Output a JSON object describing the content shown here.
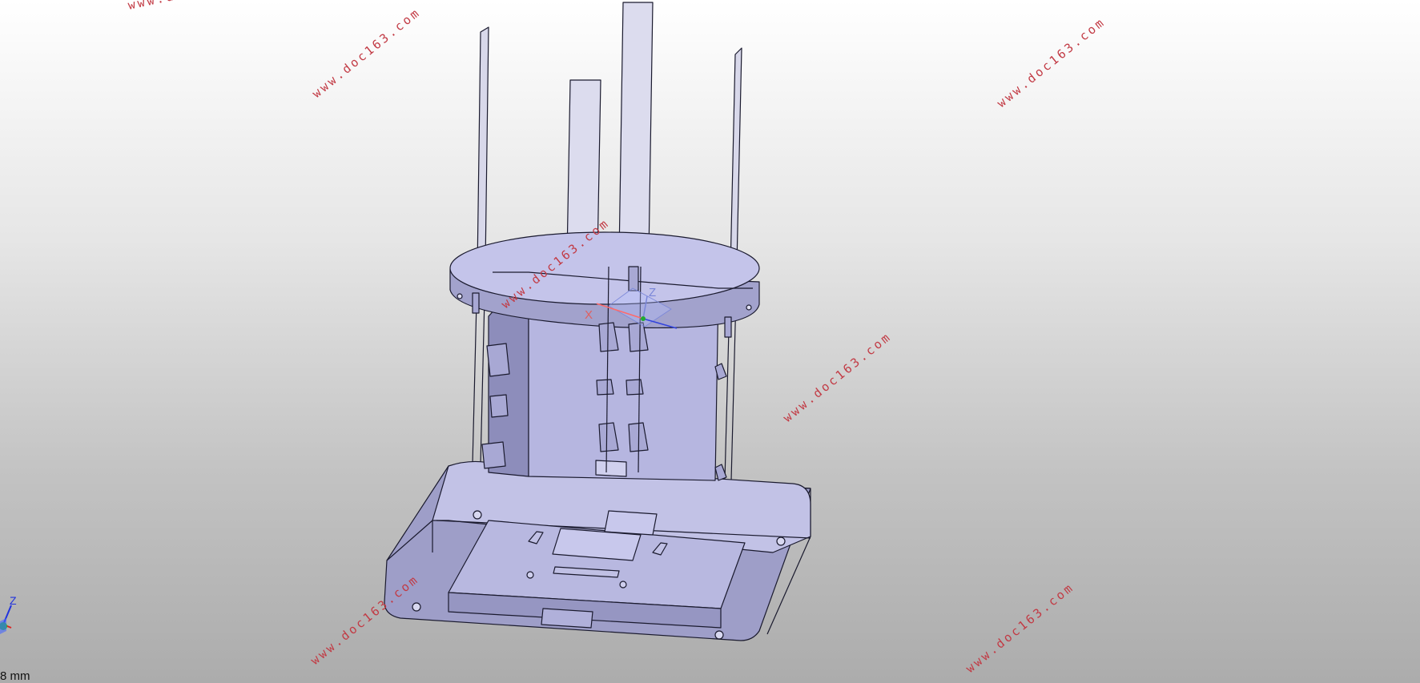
{
  "viewport": {
    "background_top": "#ffffff",
    "background_bottom": "#acacac",
    "model_face_color": "#b3b3dd",
    "model_edge_color": "#1a1a2e"
  },
  "watermarks": [
    "www.doc163.com",
    "www.doc163.com",
    "www.doc163.com",
    "www.doc163.com",
    "www.doc163.com",
    "www.doc163.com",
    "www.doc163.com"
  ],
  "model_axes": {
    "x": "X",
    "z": "Z"
  },
  "triad": {
    "z_label": "Z",
    "icon": "view-orientation-triad-icon"
  },
  "scale_bar": {
    "label": "8 mm"
  }
}
